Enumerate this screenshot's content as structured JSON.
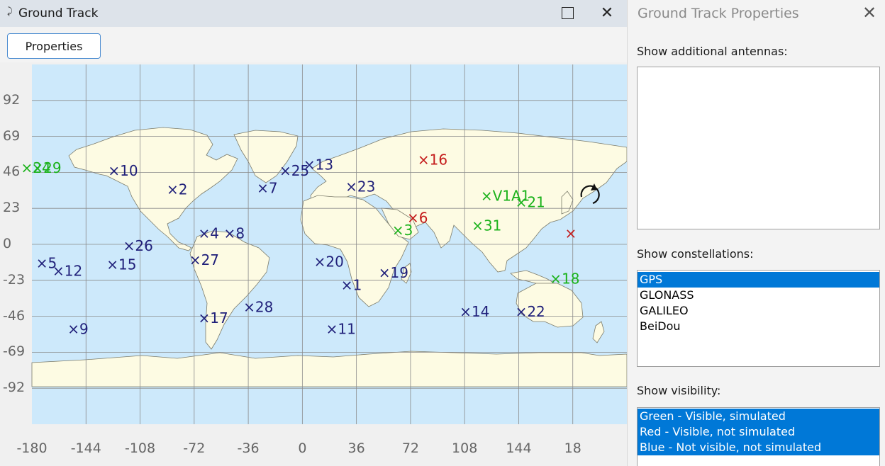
{
  "window": {
    "title": "Ground Track",
    "title_icon": "⤸",
    "maximize_icon": "maximize-icon",
    "close_icon": "close-icon",
    "close_glyph": "✕"
  },
  "toolbar": {
    "properties_label": "Properties"
  },
  "chart_data": {
    "type": "scatter",
    "x_ticks": [
      "-180",
      "-144",
      "-108",
      "-72",
      "-36",
      "0",
      "36",
      "72",
      "108",
      "144",
      "18"
    ],
    "y_ticks": [
      "92",
      "69",
      "46",
      "23",
      "0",
      "-23",
      "-46",
      "-69",
      "-92"
    ],
    "xlim": [
      -180,
      180
    ],
    "ylim": [
      -115,
      115
    ],
    "grid": true,
    "marker": "×",
    "colors": {
      "green": "#1bb21b",
      "red": "#c41a1a",
      "blue": "#20207a"
    },
    "satellites": [
      {
        "label": "24",
        "lon": -184,
        "lat": 49,
        "status": "green"
      },
      {
        "label": "29",
        "lon": -177,
        "lat": 49,
        "status": "green"
      },
      {
        "label": "10",
        "lon": -126,
        "lat": 47,
        "status": "blue"
      },
      {
        "label": "2",
        "lon": -87,
        "lat": 35,
        "status": "blue"
      },
      {
        "label": "7",
        "lon": -27,
        "lat": 36,
        "status": "blue"
      },
      {
        "label": "25",
        "lon": -12,
        "lat": 47,
        "status": "blue"
      },
      {
        "label": "13",
        "lon": 4,
        "lat": 51,
        "status": "blue"
      },
      {
        "label": "23",
        "lon": 32,
        "lat": 37,
        "status": "blue"
      },
      {
        "label": "16",
        "lon": 80,
        "lat": 54,
        "status": "red"
      },
      {
        "label": "V1A1",
        "lon": 122,
        "lat": 31,
        "status": "green"
      },
      {
        "label": "21",
        "lon": 145,
        "lat": 27,
        "status": "green"
      },
      {
        "label": "6",
        "lon": 73,
        "lat": 17,
        "status": "red"
      },
      {
        "label": "3",
        "lon": 63,
        "lat": 9,
        "status": "green"
      },
      {
        "label": "31",
        "lon": 116,
        "lat": 12,
        "status": "green"
      },
      {
        "label": "4",
        "lon": -66,
        "lat": 7,
        "status": "blue"
      },
      {
        "label": "8",
        "lon": -49,
        "lat": 7,
        "status": "blue"
      },
      {
        "label": "26",
        "lon": -116,
        "lat": -1,
        "status": "blue"
      },
      {
        "label": "27",
        "lon": -72,
        "lat": -10,
        "status": "blue"
      },
      {
        "label": "5",
        "lon": -174,
        "lat": -12,
        "status": "blue"
      },
      {
        "label": "12",
        "lon": -163,
        "lat": -17,
        "status": "blue"
      },
      {
        "label": "15",
        "lon": -127,
        "lat": -13,
        "status": "blue"
      },
      {
        "label": "20",
        "lon": 11,
        "lat": -11,
        "status": "blue"
      },
      {
        "label": "19",
        "lon": 54,
        "lat": -18,
        "status": "blue"
      },
      {
        "label": "1",
        "lon": 29,
        "lat": -26,
        "status": "blue"
      },
      {
        "label": "28",
        "lon": -36,
        "lat": -40,
        "status": "blue"
      },
      {
        "label": "17",
        "lon": -66,
        "lat": -47,
        "status": "blue"
      },
      {
        "label": "14",
        "lon": 108,
        "lat": -43,
        "status": "blue"
      },
      {
        "label": "22",
        "lon": 145,
        "lat": -43,
        "status": "blue"
      },
      {
        "label": "9",
        "lon": -153,
        "lat": -54,
        "status": "blue"
      },
      {
        "label": "11",
        "lon": 19,
        "lat": -54,
        "status": "blue"
      },
      {
        "label": "18",
        "lon": 168,
        "lat": -22,
        "status": "green"
      },
      {
        "label": "",
        "lon": 178,
        "lat": 7,
        "status": "red"
      }
    ]
  },
  "props": {
    "title": "Ground Track Properties",
    "close_glyph": "✕",
    "antennas_label": "Show additional antennas:",
    "constellations_label": "Show constellations:",
    "constellations": [
      {
        "label": "GPS",
        "selected": true
      },
      {
        "label": "GLONASS",
        "selected": false
      },
      {
        "label": "GALILEO",
        "selected": false
      },
      {
        "label": "BeiDou",
        "selected": false
      }
    ],
    "visibility_label": "Show visibility:",
    "visibility": [
      {
        "label": "Green - Visible, simulated",
        "selected": true
      },
      {
        "label": "Red - Visible, not simulated",
        "selected": true
      },
      {
        "label": "Blue - Not visible, not simulated",
        "selected": true
      }
    ]
  }
}
